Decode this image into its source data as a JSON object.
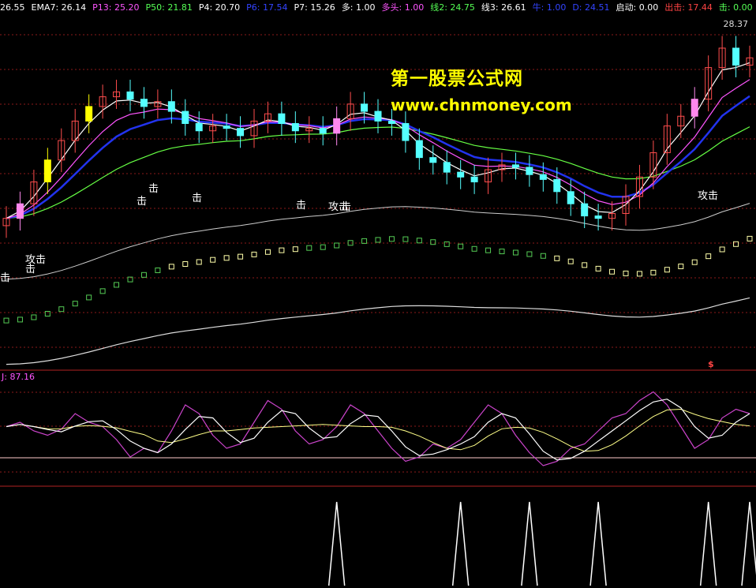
{
  "legend": [
    {
      "text": "26.55",
      "color": "#ffffff"
    },
    {
      "text": "EMA7: 26.14",
      "color": "#ffffff"
    },
    {
      "text": "P13: 25.20",
      "color": "#ff55ff"
    },
    {
      "text": "P50: 21.81",
      "color": "#55ff55"
    },
    {
      "text": "P4: 20.70",
      "color": "#ffffff"
    },
    {
      "text": "P6: 17.54",
      "color": "#3344ff"
    },
    {
      "text": "P7: 15.26",
      "color": "#ffffff"
    },
    {
      "text": "多: 1.00",
      "color": "#ffffff"
    },
    {
      "text": "多头: 1.00",
      "color": "#ff55ff"
    },
    {
      "text": "线2: 24.75",
      "color": "#55ff55"
    },
    {
      "text": "线3: 26.61",
      "color": "#ffffff"
    },
    {
      "text": "牛: 1.00",
      "color": "#3344ff"
    },
    {
      "text": "D: 24.51",
      "color": "#3344ff"
    },
    {
      "text": "启动: 0.00",
      "color": "#ffffff"
    },
    {
      "text": "出击: 17.44",
      "color": "#ff4444"
    },
    {
      "text": "击: 0.00",
      "color": "#55ff55"
    },
    {
      "text": "攻击",
      "color": "#ffffff"
    }
  ],
  "price_high_label": "28.37",
  "indicator_label": "J: 87.16",
  "dollar_sign": "$",
  "watermark": {
    "title": "第一股票公式网",
    "url": "www.chnmoney.com"
  },
  "signal_labels": {
    "ji": "击",
    "gongji": "攻击"
  },
  "colors": {
    "background": "#000000",
    "grid": "#8b1a1a",
    "up_candle": "#ff4d4d",
    "down_candle": "#54ffff",
    "pink_candle": "#ff88ee",
    "yellow_candle": "#ffff00",
    "ema7": "#ffffff",
    "p13": "#ff55ff",
    "p6": "#2233ee",
    "p50": "#66ff44",
    "p4": "#ffffff",
    "kdj_k": "#ffffff",
    "kdj_d": "#ffff88",
    "kdj_j": "#cc44cc"
  },
  "chart_data": [
    {
      "type": "candlestick",
      "title": "",
      "ylim": [
        15,
        28.37
      ],
      "close": [
        20.3,
        20.9,
        21.8,
        22.7,
        23.5,
        24.3,
        24.9,
        25.3,
        25.5,
        25.2,
        24.9,
        25.1,
        24.7,
        24.2,
        23.9,
        24.1,
        24.0,
        23.7,
        24.3,
        24.6,
        24.2,
        23.9,
        24.0,
        23.8,
        24.4,
        25.0,
        24.7,
        24.3,
        24.2,
        23.5,
        22.8,
        22.6,
        22.2,
        22.0,
        21.8,
        22.3,
        22.5,
        22.4,
        22.1,
        21.9,
        21.4,
        20.9,
        20.4,
        20.3,
        20.5,
        21.2,
        22.0,
        23.0,
        24.1,
        24.5,
        25.2,
        26.5,
        27.3,
        26.6,
        26.9
      ],
      "line_series": [
        "EMA7",
        "P13",
        "P6",
        "P50",
        "P4"
      ]
    },
    {
      "type": "line",
      "title": "",
      "ylim": [
        -10,
        110
      ],
      "series": [
        {
          "name": "J",
          "values": [
            55,
            60,
            50,
            45,
            52,
            70,
            60,
            55,
            40,
            20,
            30,
            25,
            50,
            80,
            70,
            45,
            30,
            35,
            60,
            85,
            75,
            50,
            35,
            40,
            55,
            80,
            70,
            50,
            30,
            15,
            20,
            35,
            30,
            40,
            60,
            80,
            70,
            45,
            25,
            10,
            15,
            30,
            35,
            50,
            65,
            70,
            85,
            95,
            80,
            55,
            30,
            40,
            65,
            75,
            70
          ]
        }
      ]
    },
    {
      "type": "line",
      "title": "",
      "ylim": [
        0,
        1
      ],
      "series": [
        {
          "name": "signal",
          "values": [
            0,
            0,
            0,
            0,
            0,
            0,
            0,
            0,
            0,
            0,
            0,
            0,
            0,
            0,
            0,
            0,
            0,
            0,
            0,
            0,
            0,
            0,
            0,
            0,
            1,
            0,
            0,
            0,
            0,
            0,
            0,
            0,
            0,
            1,
            0,
            0,
            0,
            0,
            1,
            0,
            0,
            0,
            0,
            1,
            0,
            0,
            0,
            0,
            0,
            0,
            0,
            1,
            0,
            0,
            1
          ]
        }
      ]
    }
  ]
}
